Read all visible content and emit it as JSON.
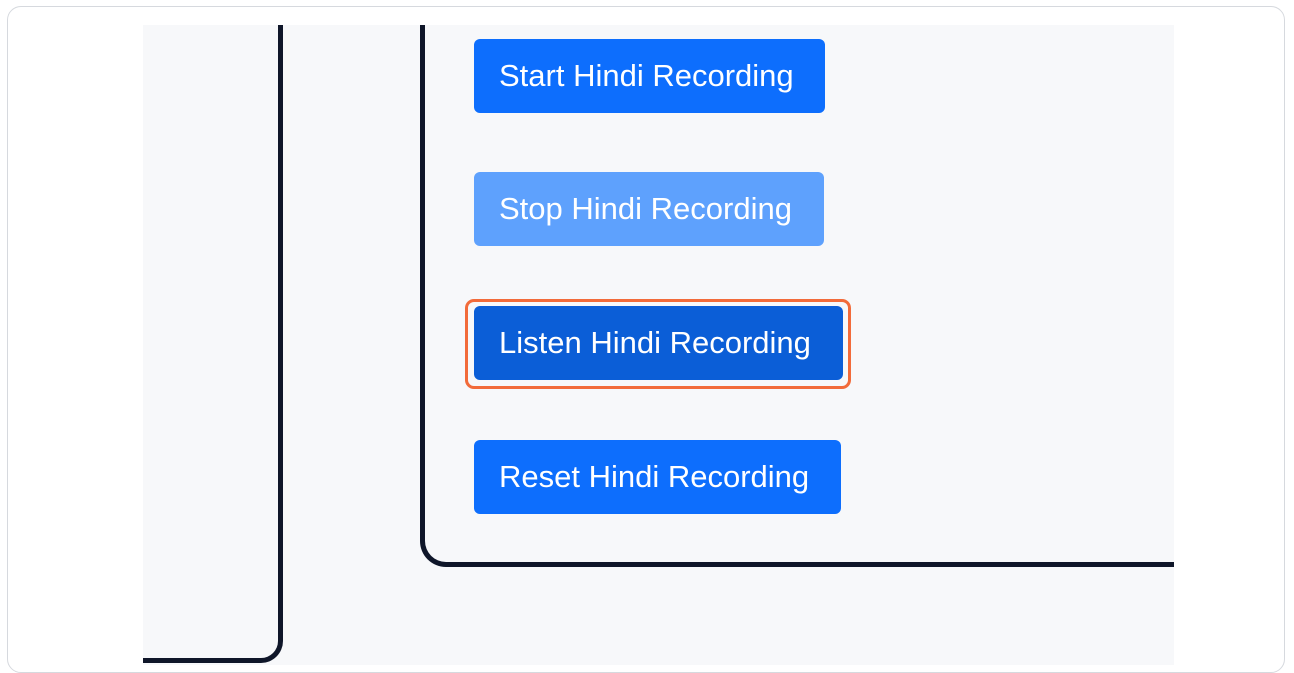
{
  "buttons": {
    "start": "Start Hindi Recording",
    "stop": "Stop Hindi Recording",
    "listen": "Listen Hindi Recording",
    "reset": "Reset Hindi Recording"
  },
  "colors": {
    "primary": "#0d6efd",
    "disabled": "#5ea1fd",
    "active": "#0b5ed7",
    "highlight": "#f26b3a",
    "border": "#0f1629",
    "background": "#f7f8fa"
  },
  "state": {
    "stop_button_disabled": true,
    "highlighted_button": "listen"
  }
}
